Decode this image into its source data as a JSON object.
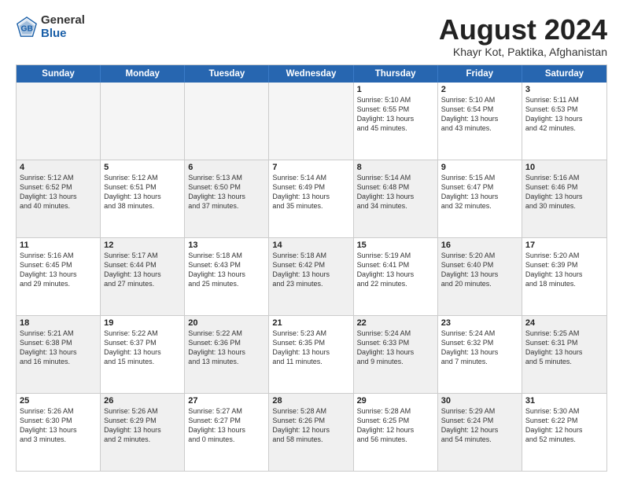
{
  "logo": {
    "general": "General",
    "blue": "Blue"
  },
  "title": "August 2024",
  "location": "Khayr Kot, Paktika, Afghanistan",
  "days": [
    "Sunday",
    "Monday",
    "Tuesday",
    "Wednesday",
    "Thursday",
    "Friday",
    "Saturday"
  ],
  "rows": [
    [
      {
        "day": "",
        "info": "",
        "empty": true
      },
      {
        "day": "",
        "info": "",
        "empty": true
      },
      {
        "day": "",
        "info": "",
        "empty": true
      },
      {
        "day": "",
        "info": "",
        "empty": true
      },
      {
        "day": "1",
        "info": "Sunrise: 5:10 AM\nSunset: 6:55 PM\nDaylight: 13 hours\nand 45 minutes."
      },
      {
        "day": "2",
        "info": "Sunrise: 5:10 AM\nSunset: 6:54 PM\nDaylight: 13 hours\nand 43 minutes."
      },
      {
        "day": "3",
        "info": "Sunrise: 5:11 AM\nSunset: 6:53 PM\nDaylight: 13 hours\nand 42 minutes."
      }
    ],
    [
      {
        "day": "4",
        "info": "Sunrise: 5:12 AM\nSunset: 6:52 PM\nDaylight: 13 hours\nand 40 minutes.",
        "shaded": true
      },
      {
        "day": "5",
        "info": "Sunrise: 5:12 AM\nSunset: 6:51 PM\nDaylight: 13 hours\nand 38 minutes."
      },
      {
        "day": "6",
        "info": "Sunrise: 5:13 AM\nSunset: 6:50 PM\nDaylight: 13 hours\nand 37 minutes.",
        "shaded": true
      },
      {
        "day": "7",
        "info": "Sunrise: 5:14 AM\nSunset: 6:49 PM\nDaylight: 13 hours\nand 35 minutes."
      },
      {
        "day": "8",
        "info": "Sunrise: 5:14 AM\nSunset: 6:48 PM\nDaylight: 13 hours\nand 34 minutes.",
        "shaded": true
      },
      {
        "day": "9",
        "info": "Sunrise: 5:15 AM\nSunset: 6:47 PM\nDaylight: 13 hours\nand 32 minutes."
      },
      {
        "day": "10",
        "info": "Sunrise: 5:16 AM\nSunset: 6:46 PM\nDaylight: 13 hours\nand 30 minutes.",
        "shaded": true
      }
    ],
    [
      {
        "day": "11",
        "info": "Sunrise: 5:16 AM\nSunset: 6:45 PM\nDaylight: 13 hours\nand 29 minutes."
      },
      {
        "day": "12",
        "info": "Sunrise: 5:17 AM\nSunset: 6:44 PM\nDaylight: 13 hours\nand 27 minutes.",
        "shaded": true
      },
      {
        "day": "13",
        "info": "Sunrise: 5:18 AM\nSunset: 6:43 PM\nDaylight: 13 hours\nand 25 minutes."
      },
      {
        "day": "14",
        "info": "Sunrise: 5:18 AM\nSunset: 6:42 PM\nDaylight: 13 hours\nand 23 minutes.",
        "shaded": true
      },
      {
        "day": "15",
        "info": "Sunrise: 5:19 AM\nSunset: 6:41 PM\nDaylight: 13 hours\nand 22 minutes."
      },
      {
        "day": "16",
        "info": "Sunrise: 5:20 AM\nSunset: 6:40 PM\nDaylight: 13 hours\nand 20 minutes.",
        "shaded": true
      },
      {
        "day": "17",
        "info": "Sunrise: 5:20 AM\nSunset: 6:39 PM\nDaylight: 13 hours\nand 18 minutes."
      }
    ],
    [
      {
        "day": "18",
        "info": "Sunrise: 5:21 AM\nSunset: 6:38 PM\nDaylight: 13 hours\nand 16 minutes.",
        "shaded": true
      },
      {
        "day": "19",
        "info": "Sunrise: 5:22 AM\nSunset: 6:37 PM\nDaylight: 13 hours\nand 15 minutes."
      },
      {
        "day": "20",
        "info": "Sunrise: 5:22 AM\nSunset: 6:36 PM\nDaylight: 13 hours\nand 13 minutes.",
        "shaded": true
      },
      {
        "day": "21",
        "info": "Sunrise: 5:23 AM\nSunset: 6:35 PM\nDaylight: 13 hours\nand 11 minutes."
      },
      {
        "day": "22",
        "info": "Sunrise: 5:24 AM\nSunset: 6:33 PM\nDaylight: 13 hours\nand 9 minutes.",
        "shaded": true
      },
      {
        "day": "23",
        "info": "Sunrise: 5:24 AM\nSunset: 6:32 PM\nDaylight: 13 hours\nand 7 minutes."
      },
      {
        "day": "24",
        "info": "Sunrise: 5:25 AM\nSunset: 6:31 PM\nDaylight: 13 hours\nand 5 minutes.",
        "shaded": true
      }
    ],
    [
      {
        "day": "25",
        "info": "Sunrise: 5:26 AM\nSunset: 6:30 PM\nDaylight: 13 hours\nand 3 minutes."
      },
      {
        "day": "26",
        "info": "Sunrise: 5:26 AM\nSunset: 6:29 PM\nDaylight: 13 hours\nand 2 minutes.",
        "shaded": true
      },
      {
        "day": "27",
        "info": "Sunrise: 5:27 AM\nSunset: 6:27 PM\nDaylight: 13 hours\nand 0 minutes."
      },
      {
        "day": "28",
        "info": "Sunrise: 5:28 AM\nSunset: 6:26 PM\nDaylight: 12 hours\nand 58 minutes.",
        "shaded": true
      },
      {
        "day": "29",
        "info": "Sunrise: 5:28 AM\nSunset: 6:25 PM\nDaylight: 12 hours\nand 56 minutes."
      },
      {
        "day": "30",
        "info": "Sunrise: 5:29 AM\nSunset: 6:24 PM\nDaylight: 12 hours\nand 54 minutes.",
        "shaded": true
      },
      {
        "day": "31",
        "info": "Sunrise: 5:30 AM\nSunset: 6:22 PM\nDaylight: 12 hours\nand 52 minutes."
      }
    ]
  ]
}
